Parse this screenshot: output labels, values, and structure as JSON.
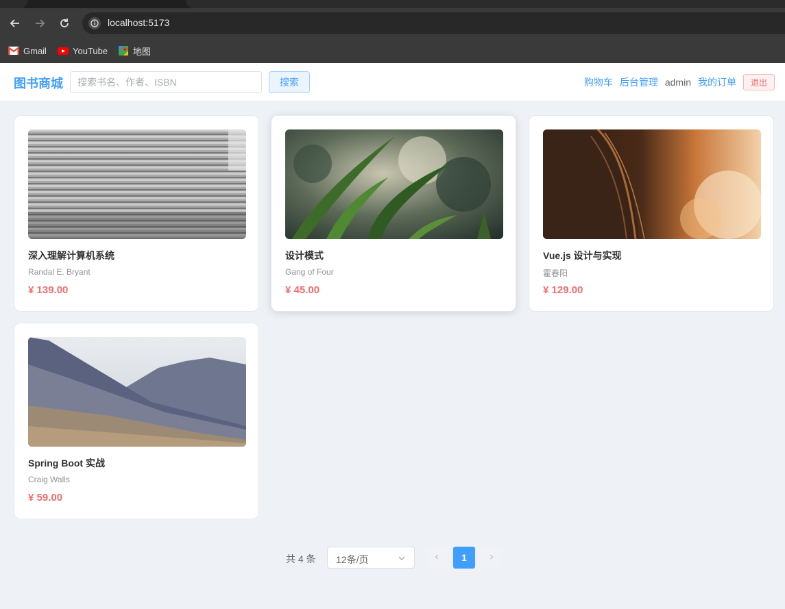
{
  "browser": {
    "url": "localhost:5173",
    "bookmarks": [
      {
        "label": "Gmail",
        "icon": "gmail-icon"
      },
      {
        "label": "YouTube",
        "icon": "youtube-icon"
      },
      {
        "label": "地图",
        "icon": "maps-icon"
      }
    ]
  },
  "header": {
    "logo": "图书商城",
    "search_placeholder": "搜索书名、作者、ISBN",
    "search_value": "",
    "search_button": "搜索",
    "nav": {
      "cart": "购物车",
      "admin_panel": "后台管理",
      "username": "admin",
      "my_orders": "我的订单",
      "logout": "退出"
    }
  },
  "books": [
    {
      "title": "深入理解计算机系统",
      "author": "Randal E. Bryant",
      "price": "¥ 139.00",
      "cover": "stairs-photo"
    },
    {
      "title": "设计模式",
      "author": "Gang of Four",
      "price": "¥ 45.00",
      "cover": "grass-photo"
    },
    {
      "title": "Vue.js 设计与实现",
      "author": "霍春阳",
      "price": "¥ 129.00",
      "cover": "hair-sunset-photo"
    },
    {
      "title": "Spring Boot 实战",
      "author": "Craig Walls",
      "price": "¥ 59.00",
      "cover": "mountains-photo"
    }
  ],
  "pagination": {
    "total": "共 4 条",
    "page_size": "12条/页",
    "current_page": "1"
  },
  "colors": {
    "primary": "#409eff",
    "danger": "#f56c6c",
    "page_bg": "#eef1f6"
  }
}
